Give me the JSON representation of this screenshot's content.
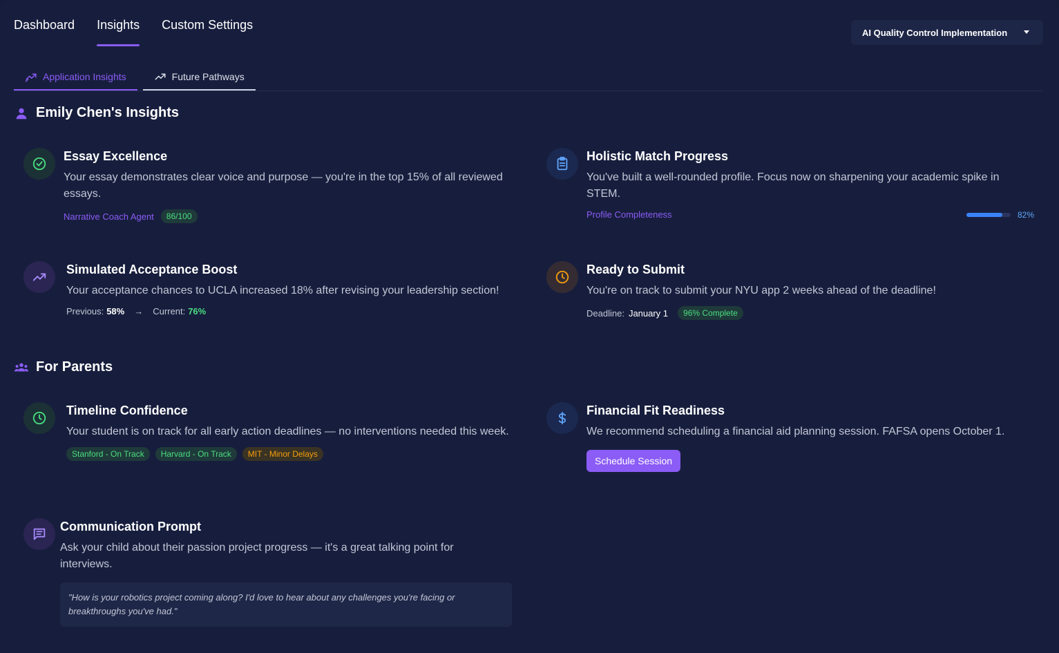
{
  "nav": {
    "tabs": [
      {
        "label": "Dashboard"
      },
      {
        "label": "Insights"
      },
      {
        "label": "Custom Settings"
      }
    ],
    "active": "Insights",
    "dropdown": {
      "selected": "AI Quality Control Implementation"
    }
  },
  "subtabs": [
    {
      "label": "Application Insights"
    },
    {
      "label": "Future Pathways"
    }
  ],
  "student_section": {
    "title": "Emily Chen's Insights",
    "cards": {
      "essay": {
        "title": "Essay Excellence",
        "text": "Your essay demonstrates clear voice and purpose — you're in the top 15% of all reviewed essays.",
        "agent": "Narrative Coach Agent",
        "score": "86/100"
      },
      "holistic": {
        "title": "Holistic Match Progress",
        "text": "You've built a well-rounded profile. Focus now on sharpening your academic spike in STEM.",
        "label": "Profile Completeness",
        "percent_label": "82%",
        "percent": 82
      },
      "boost": {
        "title": "Simulated Acceptance Boost",
        "text": "Your acceptance chances to UCLA increased 18% after revising your leadership section!",
        "previous_label": "Previous:",
        "previous_value": "58%",
        "arrow": "→",
        "current_label": "Current:",
        "current_value": "76%"
      },
      "submit": {
        "title": "Ready to Submit",
        "text": "You're on track to submit your NYU app 2 weeks ahead of the deadline!",
        "deadline_label": "Deadline:",
        "deadline_value": "January 1",
        "complete": "96% Complete"
      }
    }
  },
  "parents_section": {
    "title": "For Parents",
    "cards": {
      "timeline": {
        "title": "Timeline Confidence",
        "text": "Your student is on track for all early action deadlines — no interventions needed this week.",
        "tags": [
          "Stanford - On Track",
          "Harvard - On Track",
          "MIT - Minor Delays"
        ]
      },
      "financial": {
        "title": "Financial Fit Readiness",
        "text": "We recommend scheduling a financial aid planning session. FAFSA opens October 1.",
        "button": "Schedule Session"
      },
      "communication": {
        "title": "Communication Prompt",
        "text": "Ask your child about their passion project progress — it's a great talking point for interviews.",
        "quote": "\"How is your robotics project coming along? I'd love to hear about any challenges you're facing or breakthroughs you've had.\""
      }
    }
  },
  "colors": {
    "background": "#171e3d",
    "accent": "#8b5cf6",
    "success": "#4ade80",
    "warning": "#f59e0b",
    "progress": "#3b82f6"
  },
  "icons": {
    "student": "person-icon",
    "parents": "group-icon",
    "essay": "check-circle-icon",
    "holistic": "clipboard-icon",
    "boost": "trending-up-icon",
    "submit": "clock-icon",
    "timeline": "clock-icon",
    "financial": "dollar-icon",
    "communication": "message-icon"
  }
}
